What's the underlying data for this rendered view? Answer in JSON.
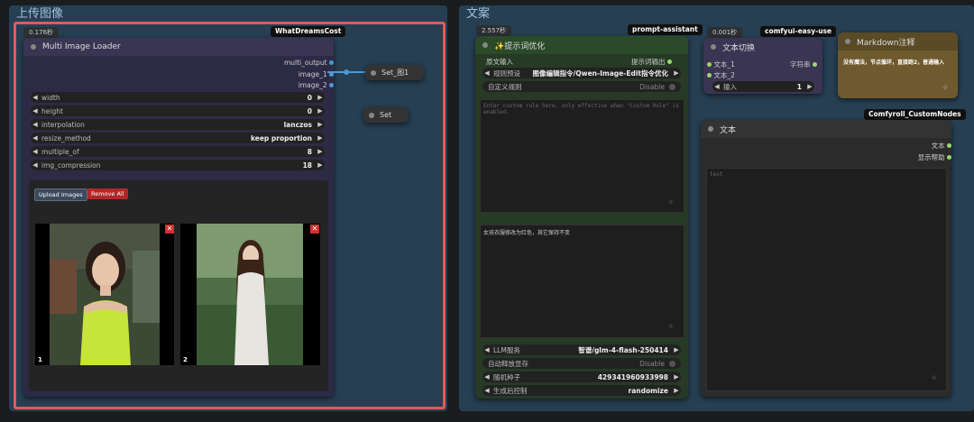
{
  "colors": {
    "group_bg": "#263f52",
    "highlight": "#e05a5a",
    "green_node": "#2a4a2a",
    "purple_node": "#3a3552",
    "dark_node": "#2b2b2b",
    "brown_node": "#6e5a2e"
  },
  "left_group": {
    "title": "上传图像",
    "timer": "0.176秒",
    "badge": "WhatDreamsCost",
    "node": {
      "title": "Multi Image Loader",
      "outputs": [
        "multi_output",
        "image_1",
        "image_2"
      ],
      "widgets": [
        {
          "label": "width",
          "value": "0"
        },
        {
          "label": "height",
          "value": "0"
        },
        {
          "label": "interpolation",
          "value": "lanczos"
        },
        {
          "label": "resize_method",
          "value": "keep proportion"
        },
        {
          "label": "multiple_of",
          "value": "8"
        },
        {
          "label": "img_compression",
          "value": "18"
        }
      ],
      "upload_btn": "Upload Images",
      "remove_btn": "Remove All",
      "images": [
        {
          "index": "1"
        },
        {
          "index": "2"
        }
      ]
    }
  },
  "set_node_1": {
    "title": "Set_图1"
  },
  "set_node_2": {
    "title": "Set"
  },
  "right_group": {
    "title": "文案",
    "prompt_node": {
      "timer": "2.557秒",
      "badge": "prompt-assistant",
      "title": "✨提示词优化",
      "input_label": "原文输入",
      "output_label": "提示词输出",
      "rule_preset": {
        "label": "规则预设",
        "value": "图像编辑指令/Qwen-Image-Edit指令优化"
      },
      "custom_rule": {
        "label": "自定义规则",
        "value": "Disable"
      },
      "placeholder_text": "Enter custom rule here, only effective when \"Custom Rule\" is enabled.",
      "prompt_text": "女孩衣服修改为红色，其它保持不变",
      "llm": {
        "label": "LLM服务",
        "value": "智谱/glm-4-flash-250414"
      },
      "auto_release": {
        "label": "自动释放显存",
        "value": "Disable"
      },
      "seed": {
        "label": "随机种子",
        "value": "429341960933998"
      },
      "control": {
        "label": "生成后控制",
        "value": "randomize"
      }
    },
    "switch_node": {
      "timer": "0.001秒",
      "badge": "comfyui-easy-use",
      "title": "文本切换",
      "inputs": [
        "文本_1",
        "文本_2"
      ],
      "output": "字符串",
      "widget": {
        "label": "输入",
        "value": "1"
      }
    },
    "markdown_node": {
      "title": "Markdown注释",
      "content": "没有魔法，节点循环，直接跑2，普通输入"
    },
    "text_node": {
      "badge": "Comfyroll_CustomNodes",
      "title": "文本",
      "outputs": [
        "文本",
        "显示帮助"
      ],
      "placeholder": "text"
    }
  }
}
